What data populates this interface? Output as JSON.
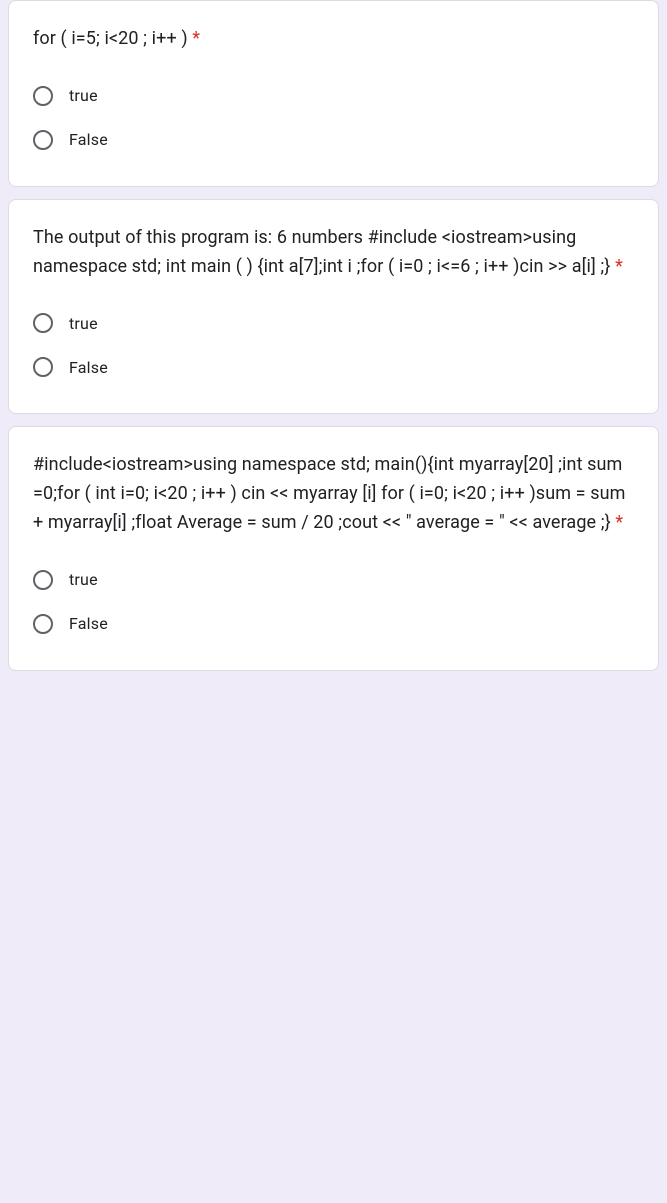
{
  "questions": [
    {
      "text": "for ( i=5; i<20 ; i++ )",
      "required": "*",
      "options": [
        "true",
        "False"
      ]
    },
    {
      "text": "The output of this program is: 6 numbers #include <iostream>using namespace std; int main ( ) {int a[7];int i ;for ( i=0 ; i<=6 ; i++ )cin >> a[i] ;}",
      "required": "*",
      "options": [
        "true",
        "False"
      ]
    },
    {
      "text": "#include<iostream>using namespace std; main(){int myarray[20] ;int sum =0;for ( int i=0; i<20 ; i++ ) cin << myarray [i] for ( i=0; i<20 ; i++ )sum = sum + myarray[i] ;float Average = sum / 20 ;cout << \" average = \" << average ;}",
      "required": "*",
      "options": [
        "true",
        "False"
      ]
    }
  ]
}
